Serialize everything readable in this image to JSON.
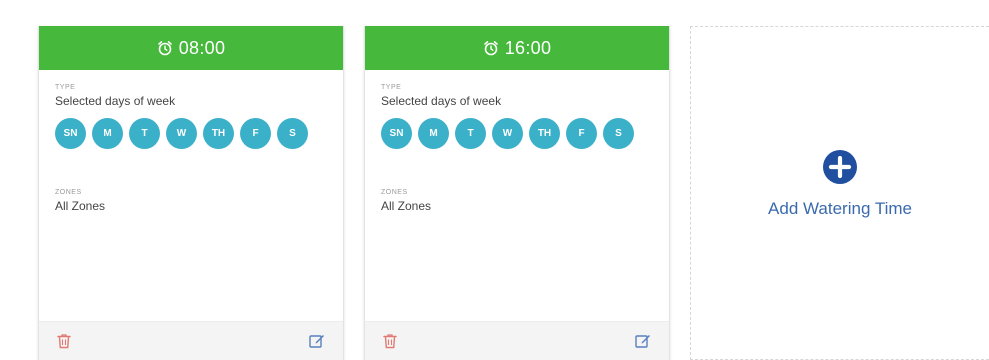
{
  "colors": {
    "header_green": "#46b83c",
    "day_teal": "#3bb0c9",
    "delete_red": "#e07a72",
    "edit_blue": "#5a7fbf",
    "add_blue": "#1f4f9e"
  },
  "schedules": [
    {
      "time": "08:00",
      "type_label": "TYPE",
      "type_value": "Selected days of week",
      "days": [
        "SN",
        "M",
        "T",
        "W",
        "TH",
        "F",
        "S"
      ],
      "zones_label": "ZONES",
      "zones_value": "All Zones"
    },
    {
      "time": "16:00",
      "type_label": "TYPE",
      "type_value": "Selected days of week",
      "days": [
        "SN",
        "M",
        "T",
        "W",
        "TH",
        "F",
        "S"
      ],
      "zones_label": "ZONES",
      "zones_value": "All Zones"
    }
  ],
  "add_card": {
    "label": "Add Watering Time",
    "icon": "plus-circle-icon"
  }
}
